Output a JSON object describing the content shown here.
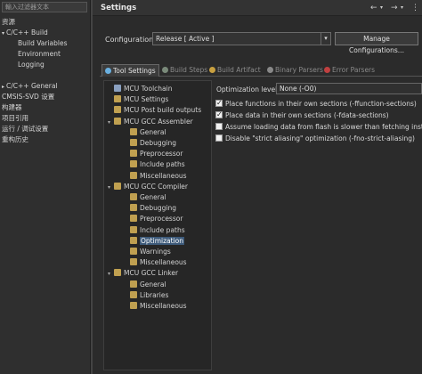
{
  "left": {
    "filter_placeholder": "輸入过滤器文本",
    "items": [
      {
        "label": "资源",
        "indent": 0
      },
      {
        "label": "C/C++ Build",
        "indent": 0,
        "toggle": "▾"
      },
      {
        "label": "Build Variables",
        "indent": 1
      },
      {
        "label": "Environment",
        "indent": 1
      },
      {
        "label": "Logging",
        "indent": 1
      },
      {
        "label": "C/C++ General",
        "indent": 0,
        "toggle": "▸"
      },
      {
        "label": "CMSIS-SVD 设置",
        "indent": 0
      },
      {
        "label": "构建器",
        "indent": 0
      },
      {
        "label": "项目引用",
        "indent": 0
      },
      {
        "label": "运行 / 调试设置",
        "indent": 0
      },
      {
        "label": "重构历史",
        "indent": 0
      }
    ]
  },
  "header": {
    "title": "Settings",
    "back_icon": "←",
    "fwd_icon": "→",
    "menu_icon": "▾",
    "more_icon": "⋮"
  },
  "config": {
    "label": "Configuration:",
    "value": "Release  [ Active ]",
    "manage_label": "Manage Configurations..."
  },
  "tabs": [
    {
      "label": "Tool Settings",
      "active": true,
      "color": "#6ab0e0"
    },
    {
      "label": "Build Steps",
      "active": false,
      "color": "#7a8a7a"
    },
    {
      "label": "Build Artifact",
      "active": false,
      "color": "#c8a040"
    },
    {
      "label": "Binary Parsers",
      "active": false,
      "color": "#888888"
    },
    {
      "label": "Error Parsers",
      "active": false,
      "color": "#c04040"
    }
  ],
  "tree": [
    {
      "label": "MCU Toolchain",
      "level": 0,
      "icon": "#8aa0c0"
    },
    {
      "label": "MCU Settings",
      "level": 0,
      "icon": "#c0a050"
    },
    {
      "label": "MCU Post build outputs",
      "level": 0,
      "icon": "#c0a050"
    },
    {
      "label": "MCU GCC Assembler",
      "level": 0,
      "icon": "#c0a050",
      "toggle": "▾"
    },
    {
      "label": "General",
      "level": 1,
      "icon": "#c0a050"
    },
    {
      "label": "Debugging",
      "level": 1,
      "icon": "#c0a050"
    },
    {
      "label": "Preprocessor",
      "level": 1,
      "icon": "#c0a050"
    },
    {
      "label": "Include paths",
      "level": 1,
      "icon": "#c0a050"
    },
    {
      "label": "Miscellaneous",
      "level": 1,
      "icon": "#c0a050"
    },
    {
      "label": "MCU GCC Compiler",
      "level": 0,
      "icon": "#c0a050",
      "toggle": "▾"
    },
    {
      "label": "General",
      "level": 1,
      "icon": "#c0a050"
    },
    {
      "label": "Debugging",
      "level": 1,
      "icon": "#c0a050"
    },
    {
      "label": "Preprocessor",
      "level": 1,
      "icon": "#c0a050"
    },
    {
      "label": "Include paths",
      "level": 1,
      "icon": "#c0a050"
    },
    {
      "label": "Optimization",
      "level": 1,
      "icon": "#c0a050",
      "selected": true
    },
    {
      "label": "Warnings",
      "level": 1,
      "icon": "#c0a050"
    },
    {
      "label": "Miscellaneous",
      "level": 1,
      "icon": "#c0a050"
    },
    {
      "label": "MCU GCC Linker",
      "level": 0,
      "icon": "#c0a050",
      "toggle": "▾"
    },
    {
      "label": "General",
      "level": 1,
      "icon": "#c0a050"
    },
    {
      "label": "Libraries",
      "level": 1,
      "icon": "#c0a050"
    },
    {
      "label": "Miscellaneous",
      "level": 1,
      "icon": "#c0a050"
    }
  ],
  "options": {
    "level_label": "Optimization level",
    "level_value": "None (-O0)",
    "checks": [
      {
        "label": "Place functions in their own sections (-ffunction-sections)",
        "checked": true
      },
      {
        "label": "Place data in their own sections (-fdata-sections)",
        "checked": true
      },
      {
        "label": "Assume loading data from flash is slower than fetching instr",
        "checked": false
      },
      {
        "label": "Disable \"strict aliasing\" optimization (-fno-strict-aliasing)",
        "checked": false
      }
    ]
  }
}
